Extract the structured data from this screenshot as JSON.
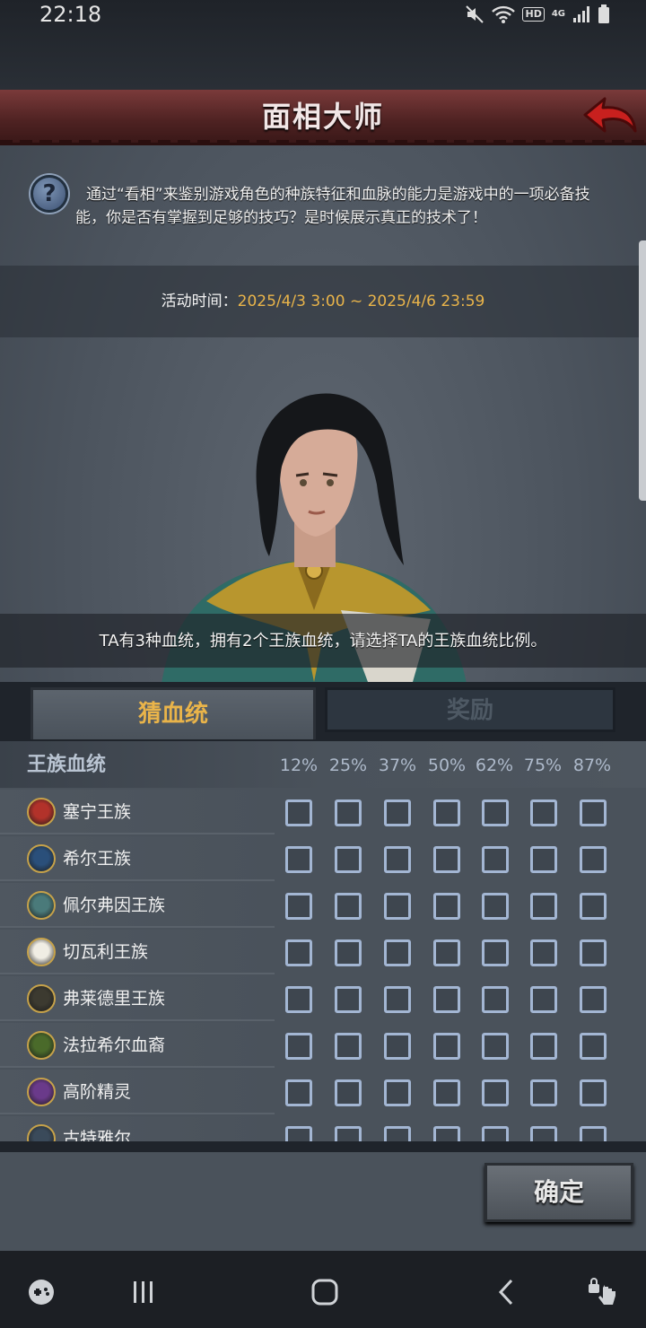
{
  "status_bar": {
    "time": "22:18",
    "hd": "HD",
    "network": "4G",
    "icons": [
      "mute-icon",
      "wifi-icon",
      "hd-icon",
      "4g-icon",
      "signal-icon",
      "battery-icon"
    ]
  },
  "header": {
    "title": "面相大师",
    "back_icon": "back-arrow-icon"
  },
  "intro": {
    "help_icon_glyph": "?",
    "text": "通过“看相”来鉴别游戏角色的种族特征和血脉的能力是游戏中的一项必备技能，你是否有掌握到足够的技巧？是时候展示真正的技术了！"
  },
  "event_time": {
    "label": "活动时间：",
    "value": "2025/4/3 3:00 ~ 2025/4/6 23:59"
  },
  "question": "TA有3种血统，拥有2个王族血统，请选择TA的王族血统比例。",
  "tabs": [
    {
      "label": "猜血统",
      "active": true
    },
    {
      "label": "奖励",
      "active": false
    }
  ],
  "table": {
    "header_label": "王族血统",
    "percentages": [
      "12%",
      "25%",
      "37%",
      "50%",
      "62%",
      "75%",
      "87%"
    ],
    "rows": [
      {
        "label": "塞宁王族",
        "emblem": "red-sun-emblem-icon",
        "color": "#b2322a"
      },
      {
        "label": "希尔王族",
        "emblem": "blue-shield-emblem-icon",
        "color": "#2a4f7a"
      },
      {
        "label": "佩尔弗因王族",
        "emblem": "mountain-emblem-icon",
        "color": "#4a7a7a"
      },
      {
        "label": "切瓦利王族",
        "emblem": "scales-emblem-icon",
        "color": "#f0ede4"
      },
      {
        "label": "弗莱德里王族",
        "emblem": "skull-emblem-icon",
        "color": "#3c3a30"
      },
      {
        "label": "法拉希尔血裔",
        "emblem": "tree-emblem-icon",
        "color": "#4a6a2a"
      },
      {
        "label": "高阶精灵",
        "emblem": "purple-eye-emblem-icon",
        "color": "#6a3a8a"
      },
      {
        "label": "古特雅尔",
        "emblem": "axe-emblem-icon",
        "color": "#3a4a5a"
      }
    ]
  },
  "footer": {
    "confirm_label": "确定"
  },
  "nav": [
    "game-launcher-icon",
    "recent-apps-icon",
    "home-icon",
    "back-icon",
    "touch-lock-icon"
  ]
}
